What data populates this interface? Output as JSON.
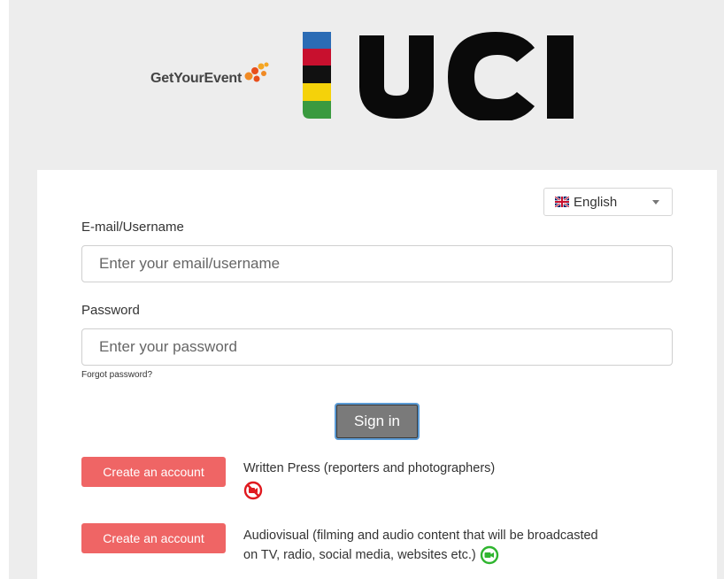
{
  "header": {
    "brand_text": "GetYourEvent",
    "uci_text": "UCI",
    "colors": {
      "blue": "#2b6cb5",
      "red": "#c8102e",
      "black": "#111111",
      "yellow": "#f5d20a",
      "green": "#3a9a3f"
    }
  },
  "language": {
    "selected": "English",
    "icon": "uk-flag-icon"
  },
  "form": {
    "email_label": "E-mail/Username",
    "email_placeholder": "Enter your email/username",
    "email_value": "",
    "password_label": "Password",
    "password_placeholder": "Enter your password",
    "password_value": "",
    "forgot_label": "Forgot password?",
    "signin_label": "Sign in"
  },
  "accounts": [
    {
      "button_label": "Create an account",
      "description": "Written Press (reporters and photographers)",
      "icon": "no-video-icon",
      "icon_color": "#e0191f"
    },
    {
      "button_label": "Create an account",
      "description_line1": "Audiovisual (filming and audio content that will be broadcasted",
      "description_line2": "on TV, radio, social media, websites etc.)",
      "icon": "video-camera-icon",
      "icon_color": "#2fb52f"
    }
  ]
}
